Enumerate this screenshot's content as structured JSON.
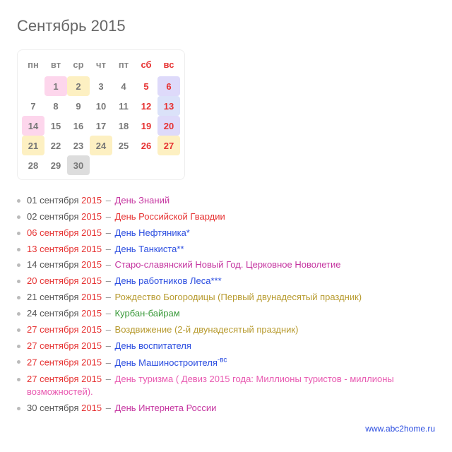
{
  "title": "Сентябрь 2015",
  "weekdays": [
    "пн",
    "вт",
    "ср",
    "чт",
    "пт",
    "сб",
    "вс"
  ],
  "weeks": [
    [
      {
        "n": ""
      },
      {
        "n": "1",
        "hl": "hl-pink"
      },
      {
        "n": "2",
        "hl": "hl-yellow"
      },
      {
        "n": "3"
      },
      {
        "n": "4"
      },
      {
        "n": "5",
        "wkend": true
      },
      {
        "n": "6",
        "wkend": true,
        "hl": "hl-lav"
      }
    ],
    [
      {
        "n": "7"
      },
      {
        "n": "8"
      },
      {
        "n": "9"
      },
      {
        "n": "10"
      },
      {
        "n": "11"
      },
      {
        "n": "12",
        "wkend": true
      },
      {
        "n": "13",
        "wkend": true,
        "hl": "hl-blue"
      }
    ],
    [
      {
        "n": "14",
        "hl": "hl-pink"
      },
      {
        "n": "15"
      },
      {
        "n": "16"
      },
      {
        "n": "17"
      },
      {
        "n": "18"
      },
      {
        "n": "19",
        "wkend": true
      },
      {
        "n": "20",
        "wkend": true,
        "hl": "hl-lav"
      }
    ],
    [
      {
        "n": "21",
        "hl": "hl-yellow"
      },
      {
        "n": "22"
      },
      {
        "n": "23"
      },
      {
        "n": "24",
        "hl": "hl-yellow"
      },
      {
        "n": "25"
      },
      {
        "n": "26",
        "wkend": true
      },
      {
        "n": "27",
        "wkend": true,
        "hl": "hl-yellow"
      }
    ],
    [
      {
        "n": "28"
      },
      {
        "n": "29"
      },
      {
        "n": "30",
        "hl": "today"
      },
      {
        "n": ""
      },
      {
        "n": ""
      },
      {
        "n": ""
      },
      {
        "n": ""
      }
    ]
  ],
  "events": [
    {
      "date": "01 сентября 2015",
      "dclass": "d-plain",
      "title": "День Знаний",
      "tclass": "t-purple"
    },
    {
      "date": "02 сентября 2015",
      "dclass": "d-plain",
      "title": "День Российской Гвардии",
      "tclass": "t-red"
    },
    {
      "date": "06 сентября 2015",
      "dclass": "d-red",
      "title": "День Нефтяника*",
      "tclass": "t-blue"
    },
    {
      "date": "13 сентября 2015",
      "dclass": "d-red",
      "title": "День Танкиста**",
      "tclass": "t-blue"
    },
    {
      "date": "14 сентября 2015",
      "dclass": "d-plain",
      "title": "Старо-славянский Новый Год. Церковное Новолетие",
      "tclass": "t-purple"
    },
    {
      "date": "20 сентября 2015",
      "dclass": "d-red",
      "title": "День работников Леса***",
      "tclass": "t-blue"
    },
    {
      "date": "21 сентября 2015",
      "dclass": "d-plain",
      "title": "Рождество Богородицы (Первый двунадесятый праздник)",
      "tclass": "t-olive"
    },
    {
      "date": "24 сентября 2015",
      "dclass": "d-plain",
      "title": "Курбан-байрам",
      "tclass": "t-green"
    },
    {
      "date": "27 сентября 2015",
      "dclass": "d-red",
      "title": "Воздвижение (2-й двунадесятый праздник)",
      "tclass": "t-olive"
    },
    {
      "date": "27 сентября 2015",
      "dclass": "d-red",
      "title": "День воспитателя",
      "tclass": "t-blue"
    },
    {
      "date": "27 сентября 2015",
      "dclass": "d-red",
      "title": "День Машиностроителя",
      "tclass": "t-blue",
      "sup": "-вс"
    },
    {
      "date": "27 сентября 2015",
      "dclass": "d-red",
      "title": "День туризма ( Девиз 2015 года: Миллионы туристов - миллионы возможностей).",
      "tclass": "t-pink"
    },
    {
      "date": "30 сентября 2015",
      "dclass": "d-plain",
      "title": "День Интернета России",
      "tclass": "t-purple"
    }
  ],
  "source": {
    "label": "www.abc2home.ru"
  }
}
